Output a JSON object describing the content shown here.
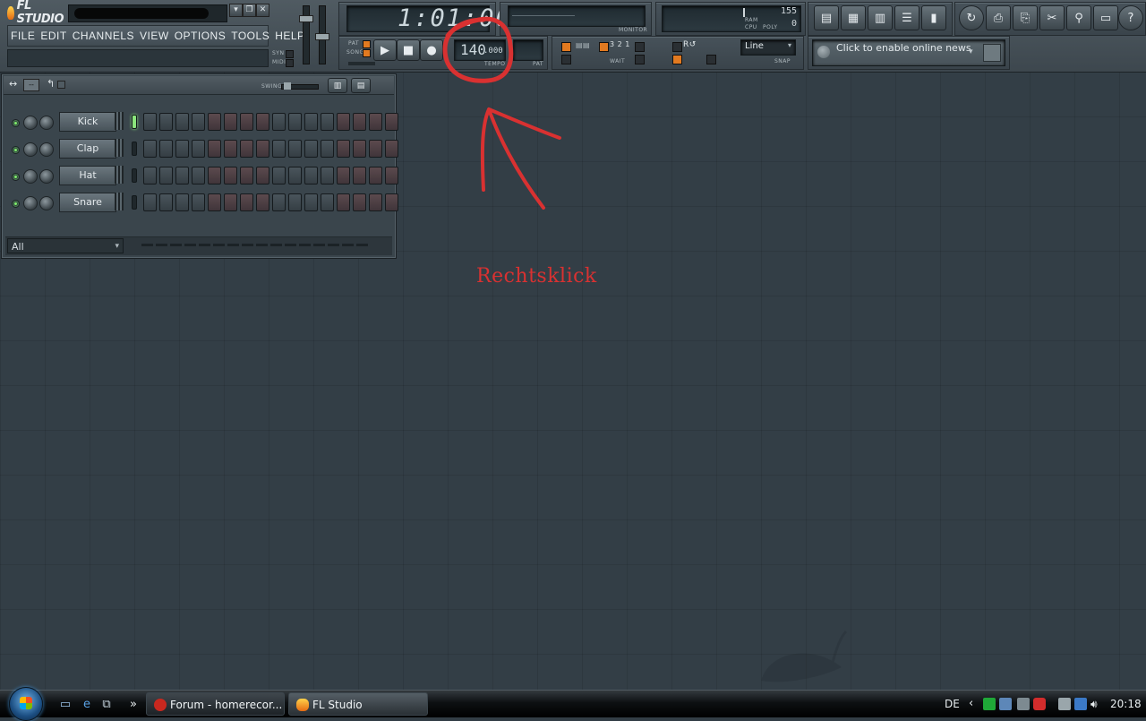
{
  "app": {
    "logo_text": "FL STUDIO",
    "menu": [
      "FILE",
      "EDIT",
      "CHANNELS",
      "VIEW",
      "OPTIONS",
      "TOOLS",
      "HELP"
    ],
    "window_buttons": [
      "▾",
      "❐",
      "✕"
    ]
  },
  "transport": {
    "song_position": "1:01:00",
    "tempo": "140",
    "tempo_decimals": ".000",
    "tempo_label": "TEMPO",
    "pat_label": "PAT",
    "pattern_label": "PAT",
    "song_label": "SONG",
    "syn_label": "SYN",
    "midi_label": "MIDI",
    "monitor_label": "MONITOR",
    "cpu_label": "CPU",
    "poly_label": "POLY",
    "ram_label": "RAM",
    "mem_value": "155",
    "poly_value": "0",
    "snap_value": "Line",
    "snap_label": "SNAP",
    "wait_label": "WAIT"
  },
  "news": {
    "text": "Click to enable online news"
  },
  "channel_rack": {
    "swing_label": "SWING",
    "filter_value": "All",
    "channels": [
      {
        "name": "Kick",
        "selected": true
      },
      {
        "name": "Clap",
        "selected": false
      },
      {
        "name": "Hat",
        "selected": false
      },
      {
        "name": "Snare",
        "selected": false
      }
    ]
  },
  "annotation": {
    "text": "Rechtsklick",
    "color": "#d93131"
  },
  "taskbar": {
    "tasks": [
      {
        "label": "Forum - homerecor..."
      },
      {
        "label": "FL Studio"
      }
    ],
    "language": "DE",
    "clock": "20:18",
    "overflow": "»"
  },
  "icons": {
    "toolbar_right": [
      "playlist-icon",
      "step-sequencer-icon",
      "piano-roll-icon",
      "browser-icon",
      "mixer-icon"
    ],
    "toolbar_far_right": [
      "undo-icon",
      "save-icon",
      "save-as-icon",
      "cut-icon",
      "search-icon",
      "render-icon",
      "help-icon"
    ],
    "quicklaunch": [
      "show-desktop-icon",
      "internet-explorer-icon",
      "switch-windows-icon"
    ]
  }
}
